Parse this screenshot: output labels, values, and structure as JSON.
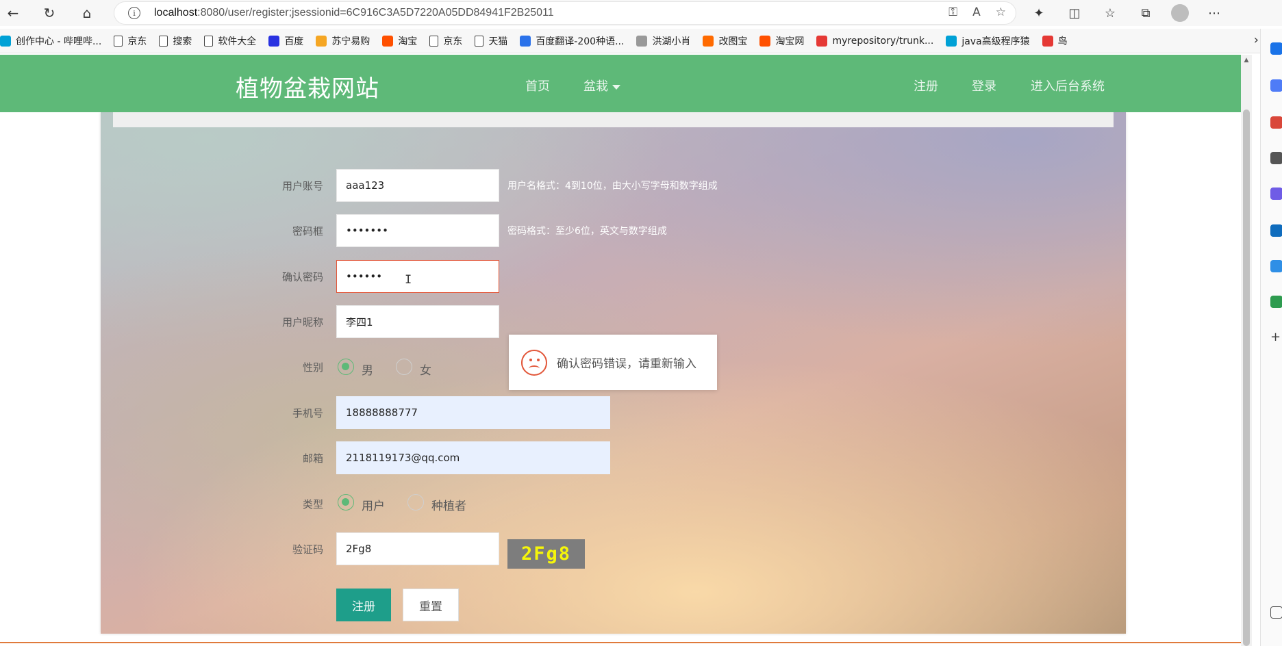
{
  "browser": {
    "url_host": "localhost",
    "url_rest": ":8080/user/register;jsessionid=6C916C3A5D7220A05DD84941F2B25011",
    "bookmarks": [
      {
        "label": "创作中心 - 哔哩哔...",
        "color": "#00a1d6"
      },
      {
        "label": "京东",
        "color": "#ffffff"
      },
      {
        "label": "搜索",
        "color": "#ffffff"
      },
      {
        "label": "软件大全",
        "color": "#ffffff"
      },
      {
        "label": "百度",
        "color": "#2932e1"
      },
      {
        "label": "苏宁易购",
        "color": "#f5a623"
      },
      {
        "label": "淘宝",
        "color": "#ff5000"
      },
      {
        "label": "京东",
        "color": "#ffffff"
      },
      {
        "label": "天猫",
        "color": "#ffffff"
      },
      {
        "label": "百度翻译-200种语...",
        "color": "#2b72ea"
      },
      {
        "label": "洪湖小肖",
        "color": "#999999"
      },
      {
        "label": "改图宝",
        "color": "#ff6a00"
      },
      {
        "label": "淘宝网",
        "color": "#ff5000"
      },
      {
        "label": "myrepository/trunk...",
        "color": "#e53935"
      },
      {
        "label": "java高级程序猿",
        "color": "#00a1d6"
      },
      {
        "label": "鸟",
        "color": "#e53935"
      }
    ]
  },
  "site": {
    "logo": "植物盆栽网站",
    "nav": {
      "home": "首页",
      "bonsai": "盆栽",
      "register": "注册",
      "login": "登录",
      "admin": "进入后台系统"
    }
  },
  "form": {
    "username_label": "用户账号",
    "username_value": "aaa123",
    "username_hint": "用户名格式：4到10位，由大小写字母和数字组成",
    "password_label": "密码框",
    "password_value": "•••••••",
    "password_hint": "密码格式：至少6位，英文与数字组成",
    "confirm_label": "确认密码",
    "confirm_value": "••••••",
    "nickname_label": "用户昵称",
    "nickname_value": "李四1",
    "gender_label": "性别",
    "gender_male": "男",
    "gender_female": "女",
    "phone_label": "手机号",
    "phone_value": "18888888777",
    "email_label": "邮箱",
    "email_value": "2118119173@qq.com",
    "type_label": "类型",
    "type_user": "用户",
    "type_grower": "种植者",
    "captcha_label": "验证码",
    "captcha_value": "2Fg8",
    "captcha_image_text": "2Fg8",
    "submit": "注册",
    "reset": "重置"
  },
  "toast": {
    "message": "确认密码错误，请重新输入"
  },
  "colors": {
    "nav_green": "#5eb978",
    "submit_teal": "#1e9e8a",
    "error_red": "#e2573a",
    "captcha_yellow": "#f5f50a"
  }
}
